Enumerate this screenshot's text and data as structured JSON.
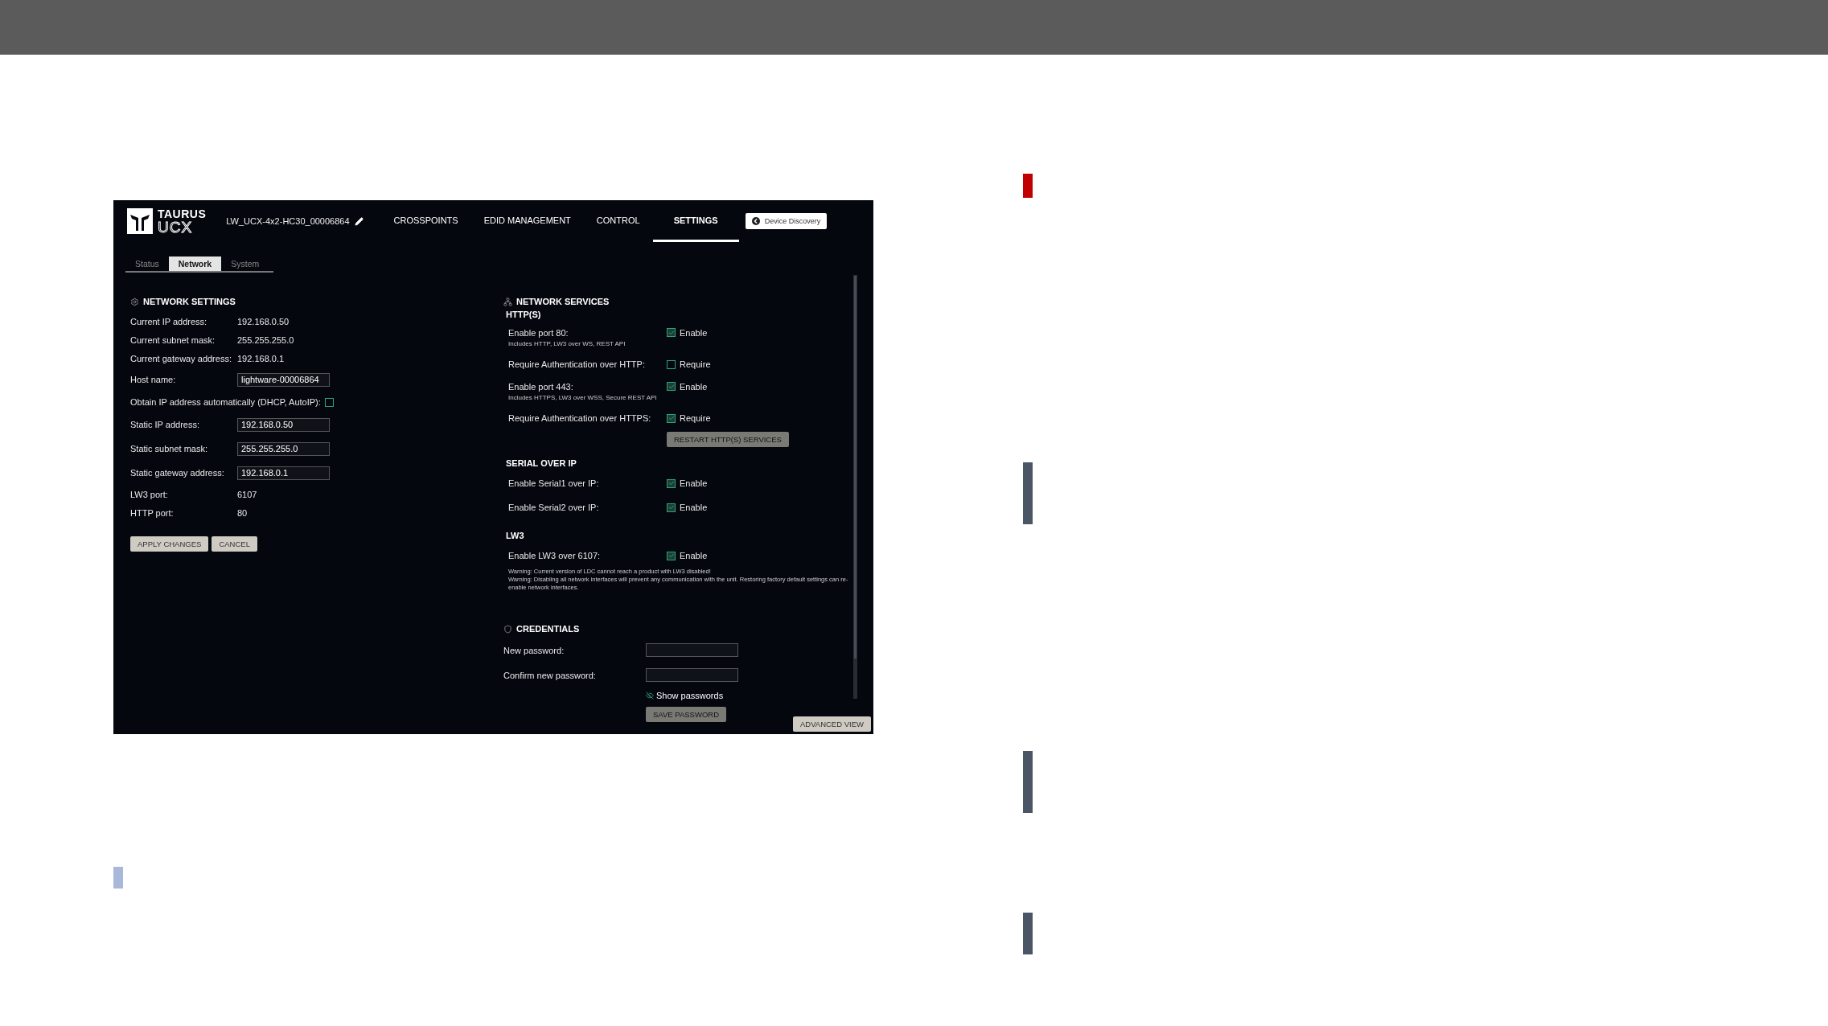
{
  "app": {
    "logo": {
      "line_1": "TAURUS",
      "line_2": "UCX"
    },
    "device_name": "LW_UCX-4x2-HC30_00006864",
    "nav": [
      {
        "label": "CROSSPOINTS",
        "selected": false
      },
      {
        "label": "EDID MANAGEMENT",
        "selected": false
      },
      {
        "label": "CONTROL",
        "selected": false
      },
      {
        "label": "SETTINGS",
        "selected": true
      }
    ],
    "discovery_button": "Device Discovery"
  },
  "subtabs": [
    {
      "label": "Status",
      "selected": false
    },
    {
      "label": "Network",
      "selected": true
    },
    {
      "label": "System",
      "selected": false
    }
  ],
  "network_settings": {
    "title": "NETWORK SETTINGS",
    "rows": [
      {
        "kind": "text",
        "label": "Current IP address:",
        "value": "192.168.0.50"
      },
      {
        "kind": "text",
        "label": "Current subnet mask:",
        "value": "255.255.255.0"
      },
      {
        "kind": "text",
        "label": "Current gateway address:",
        "value": "192.168.0.1"
      },
      {
        "kind": "input",
        "label": "Host name:",
        "value": "lightware-00006864"
      },
      {
        "kind": "checkbox",
        "label": "Obtain IP address automatically (DHCP, AutoIP):",
        "checked": false
      },
      {
        "kind": "input",
        "label": "Static IP address:",
        "value": "192.168.0.50"
      },
      {
        "kind": "input",
        "label": "Static subnet mask:",
        "value": "255.255.255.0"
      },
      {
        "kind": "input",
        "label": "Static gateway address:",
        "value": "192.168.0.1"
      },
      {
        "kind": "text",
        "label": "LW3 port:",
        "value": "6107"
      },
      {
        "kind": "text",
        "label": "HTTP port:",
        "value": "80"
      }
    ],
    "buttons": [
      {
        "label": "APPLY CHANGES",
        "disabled": false
      },
      {
        "label": "CANCEL",
        "disabled": false
      }
    ]
  },
  "network_services": {
    "title": "NETWORK SERVICES",
    "groups": [
      {
        "title": "HTTP(S)",
        "rows": [
          {
            "label": "Enable port 80:",
            "option": "Enable",
            "checked": true,
            "note": "Includes HTTP, LW3 over WS, REST API"
          },
          {
            "label": "Require Authentication over HTTP:",
            "option": "Require",
            "checked": false
          },
          {
            "label": "Enable port 443:",
            "option": "Enable",
            "checked": true,
            "note": "Includes HTTPS, LW3 over WSS, Secure REST API"
          },
          {
            "label": "Require Authentication over HTTPS:",
            "option": "Require",
            "checked": true
          }
        ],
        "button": {
          "label": "RESTART HTTP(S) SERVICES",
          "disabled": true
        }
      },
      {
        "title": "SERIAL OVER IP",
        "rows": [
          {
            "label": "Enable Serial1 over IP:",
            "option": "Enable",
            "checked": true
          },
          {
            "label": "Enable Serial2 over IP:",
            "option": "Enable",
            "checked": true
          }
        ]
      },
      {
        "title": "LW3",
        "rows": [
          {
            "label": "Enable LW3 over 6107:",
            "option": "Enable",
            "checked": true
          }
        ],
        "warnings": [
          "Warning: Current version of LDC cannot reach a product with LW3 disabled!",
          "Warning: Disabling all network interfaces will prevent any communication with the unit. Restoring factory default settings can re-enable network interfaces."
        ]
      }
    ]
  },
  "credentials": {
    "title": "CREDENTIALS",
    "fields": [
      {
        "label": "New password:"
      },
      {
        "label": "Confirm new password:"
      }
    ],
    "show_passwords": {
      "label": "Show passwords",
      "on": false
    },
    "button": {
      "label": "SAVE PASSWORD",
      "disabled": true
    }
  },
  "advanced_button": {
    "label": "ADVANCED VIEW",
    "disabled": false
  }
}
